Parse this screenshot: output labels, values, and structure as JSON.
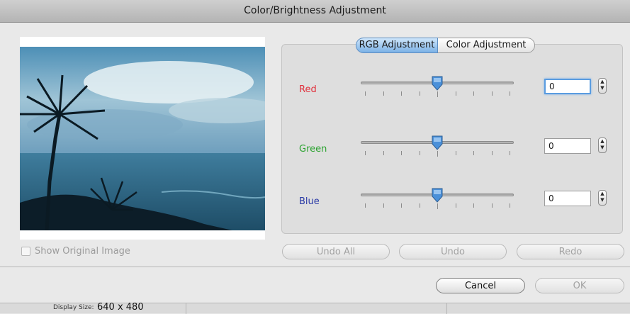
{
  "window": {
    "title": "Color/Brightness Adjustment"
  },
  "preview": {
    "show_original_label": "Show Original Image",
    "show_original_checked": false
  },
  "tabs": [
    {
      "label": "RGB Adjustment",
      "selected": true
    },
    {
      "label": "Color Adjustment",
      "selected": false
    }
  ],
  "channels": [
    {
      "label": "Red",
      "value": "0",
      "color": "#e0303c",
      "slider_fraction": 0.5
    },
    {
      "label": "Green",
      "value": "0",
      "color": "#2aa22f",
      "slider_fraction": 0.5
    },
    {
      "label": "Blue",
      "value": "0",
      "color": "#2a3aa6",
      "slider_fraction": 0.5
    }
  ],
  "history_buttons": {
    "undo_all": "Undo All",
    "undo": "Undo",
    "redo": "Redo"
  },
  "actions": {
    "cancel": "Cancel",
    "ok": "OK"
  },
  "status": {
    "display_size_label": "Display Size:",
    "display_size_value": "640 x 480"
  },
  "colors": {
    "accent": "#5a9ce0",
    "tab_selected": "#7bb1e6"
  }
}
